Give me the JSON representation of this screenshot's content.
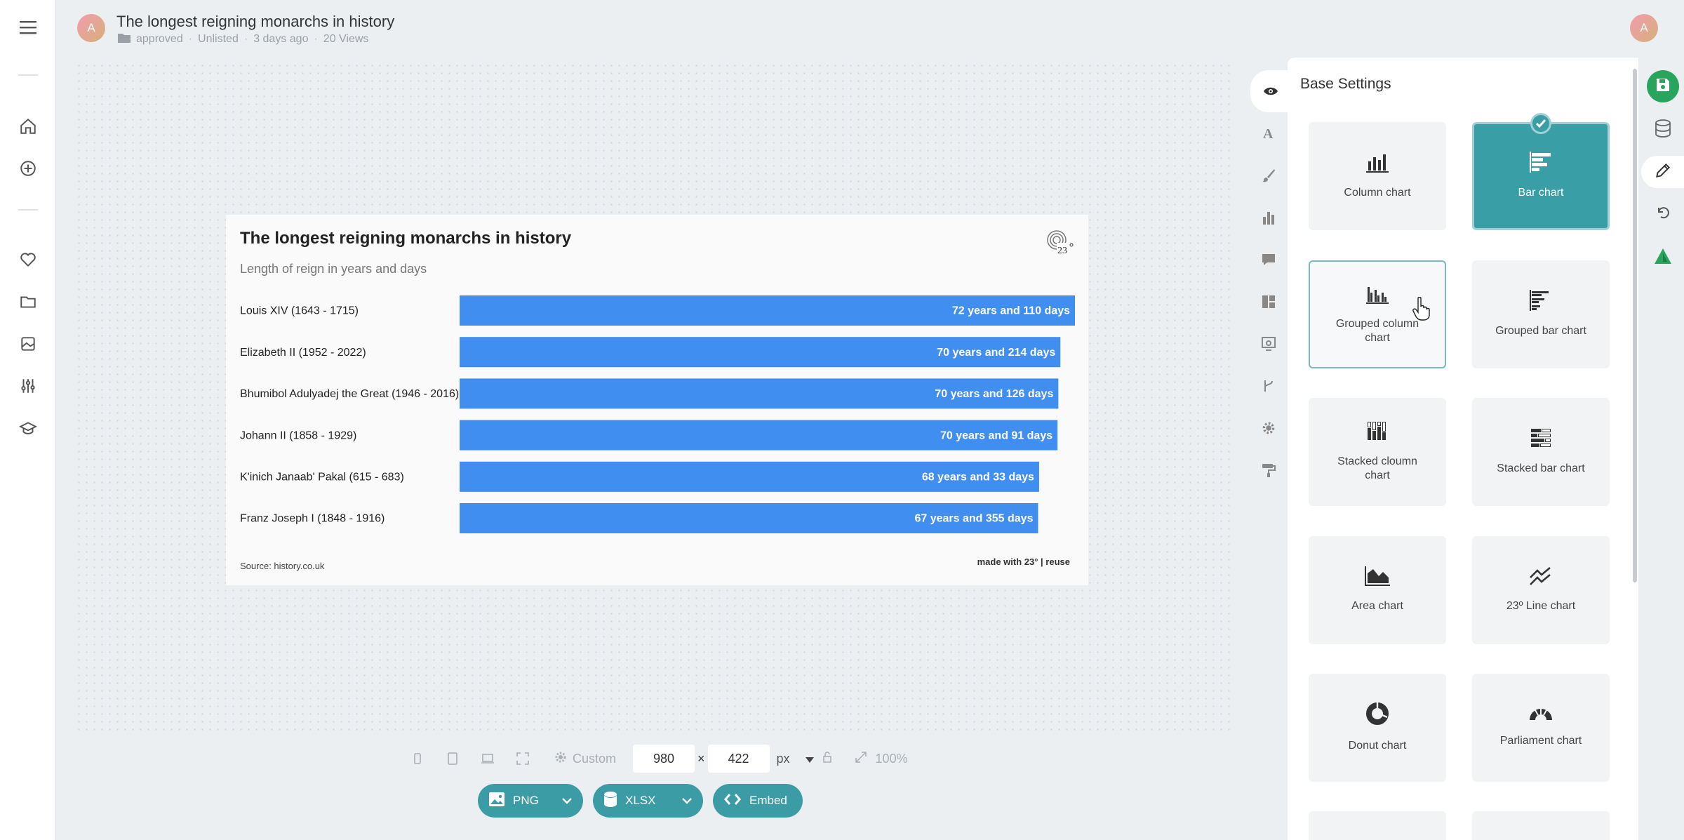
{
  "header": {
    "avatar_letter": "A",
    "title": "The longest reigning monarchs in history",
    "folder": "approved",
    "visibility": "Unlisted",
    "time": "3 days ago",
    "views": "20 Views",
    "user_letter": "A"
  },
  "chart_data": {
    "type": "bar",
    "orientation": "horizontal",
    "title": "The longest reigning monarchs in history",
    "subtitle": "Length of reign in years and days",
    "categories": [
      "Louis XIV (1643 - 1715)",
      "Elizabeth II (1952 - 2022)",
      "Bhumibol Adulyadej the Great (1946 - 2016)",
      "Johann II (1858 - 1929)",
      "K'inich Janaab' Pakal (615 - 683)",
      "Franz Joseph I (1848 - 1916)"
    ],
    "values": [
      72.3,
      70.59,
      70.35,
      70.25,
      68.09,
      67.97
    ],
    "data_labels": [
      "72 years and 110 days",
      "70 years and 214 days",
      "70 years and 126 days",
      "70 years and 91 days",
      "68 years and 33 days",
      "67 years and 355 days"
    ],
    "bar_color": "#3f8ef0",
    "source": "Source: history.co.uk",
    "made_with": "made with 23° | reuse",
    "legend": "none",
    "grid": false
  },
  "sizebar": {
    "preset": "Custom",
    "width": "980",
    "times": "×",
    "height": "422",
    "unit": "px",
    "zoom": "100%"
  },
  "export": {
    "png": "PNG",
    "xlsx": "XLSX",
    "embed": "Embed"
  },
  "panel": {
    "title": "Base Settings",
    "tiles": [
      {
        "label": "Column chart",
        "icon": "column-chart-icon"
      },
      {
        "label": "Bar chart",
        "icon": "bar-chart-icon",
        "selected": true
      },
      {
        "label": "Grouped column chart",
        "icon": "grouped-column-icon"
      },
      {
        "label": "Grouped bar chart",
        "icon": "grouped-bar-icon"
      },
      {
        "label": "Stacked cloumn chart",
        "icon": "stacked-column-icon"
      },
      {
        "label": "Stacked bar chart",
        "icon": "stacked-bar-icon"
      },
      {
        "label": "Area chart",
        "icon": "area-chart-icon"
      },
      {
        "label": "23º Line chart",
        "icon": "line-chart-icon"
      },
      {
        "label": "Donut chart",
        "icon": "donut-chart-icon"
      },
      {
        "label": "Parliament chart",
        "icon": "parliament-chart-icon"
      }
    ]
  },
  "colors": {
    "accent": "#3a9ea7",
    "save": "#27a55c"
  }
}
